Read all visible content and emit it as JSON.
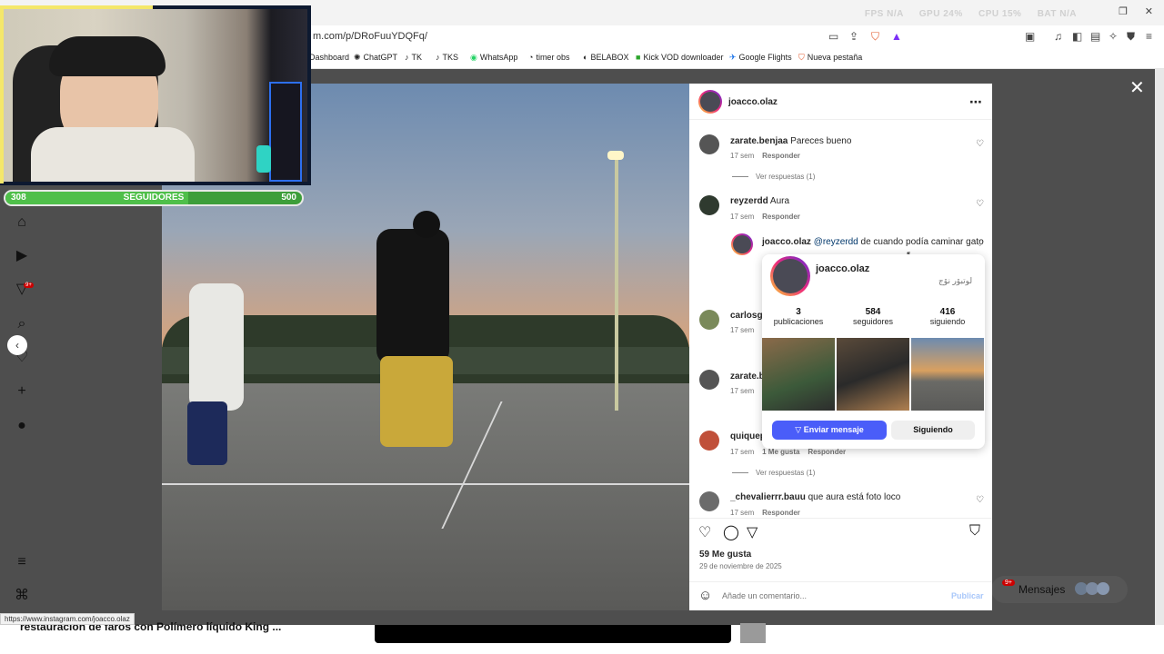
{
  "browser": {
    "url": "m.com/p/DRoFuuYDQFq/",
    "stats": [
      "FPS N/A",
      "GPU 24%",
      "CPU 15%",
      "BAT N/A"
    ],
    "bookmarks": [
      {
        "label": "Dashboard",
        "icon": "dashboard-icon"
      },
      {
        "label": "ChatGPT",
        "icon": "chatgpt-icon"
      },
      {
        "label": "TK",
        "icon": "tiktok-icon"
      },
      {
        "label": "TKS",
        "icon": "tiktok-icon"
      },
      {
        "label": "WhatsApp",
        "icon": "whatsapp-icon"
      },
      {
        "label": "timer obs",
        "icon": "timer-icon"
      },
      {
        "label": "BELABOX",
        "icon": "belabox-icon"
      },
      {
        "label": "Kick VOD downloader",
        "icon": "kick-icon"
      },
      {
        "label": "Google Flights",
        "icon": "flights-icon"
      },
      {
        "label": "Nueva pestaña",
        "icon": "brave-icon"
      }
    ],
    "status_url": "https://www.instagram.com/joacco.olaz"
  },
  "stream": {
    "followers_current": "308",
    "followers_label": "SEGUIDORES",
    "followers_goal": "500",
    "progress_fraction": 0.616
  },
  "post": {
    "author": "joacco.olaz",
    "likes": "59 Me gusta",
    "date": "29 de noviembre de 2025",
    "comment_placeholder": "Añade un comentario...",
    "publish_label": "Publicar",
    "comments": [
      {
        "user": "zarate.benjaa",
        "text": "Pareces bueno",
        "age": "17 sem",
        "reply": "Responder",
        "view_replies": "Ver respuestas (1)"
      },
      {
        "user": "reyzerdd",
        "text": "Aura",
        "age": "17 sem",
        "reply": "Responder"
      },
      {
        "user": "joacco.olaz",
        "mention": "@reyzerdd",
        "text": "de cuando podía caminar gato"
      },
      {
        "user": "carlosgu",
        "age": "17 sem"
      },
      {
        "user": "zarate.be",
        "age": "17 sem"
      },
      {
        "user": "quiquep",
        "age": "17 sem",
        "likes": "1 Me gusta",
        "reply": "Responder",
        "view_replies": "Ver respuestas (1)"
      },
      {
        "user": "_chevalierrr.bauu",
        "text": "que aura está foto loco",
        "age": "17 sem",
        "reply": "Responder"
      }
    ]
  },
  "hover_card": {
    "username": "joacco.olaz",
    "display_name": "لوتبۆر نۆج",
    "stats": [
      {
        "value": "3",
        "label": "publicaciones"
      },
      {
        "value": "584",
        "label": "seguidores"
      },
      {
        "value": "416",
        "label": "siguiendo"
      }
    ],
    "send_label": "Enviar mensaje",
    "following_label": "Siguiendo"
  },
  "background_page": {
    "video_title": "restauración de faros con Polímero líquido King ...",
    "messages_label": "Mensajes",
    "messages_badge": "9+",
    "nav_badge": "9+"
  }
}
